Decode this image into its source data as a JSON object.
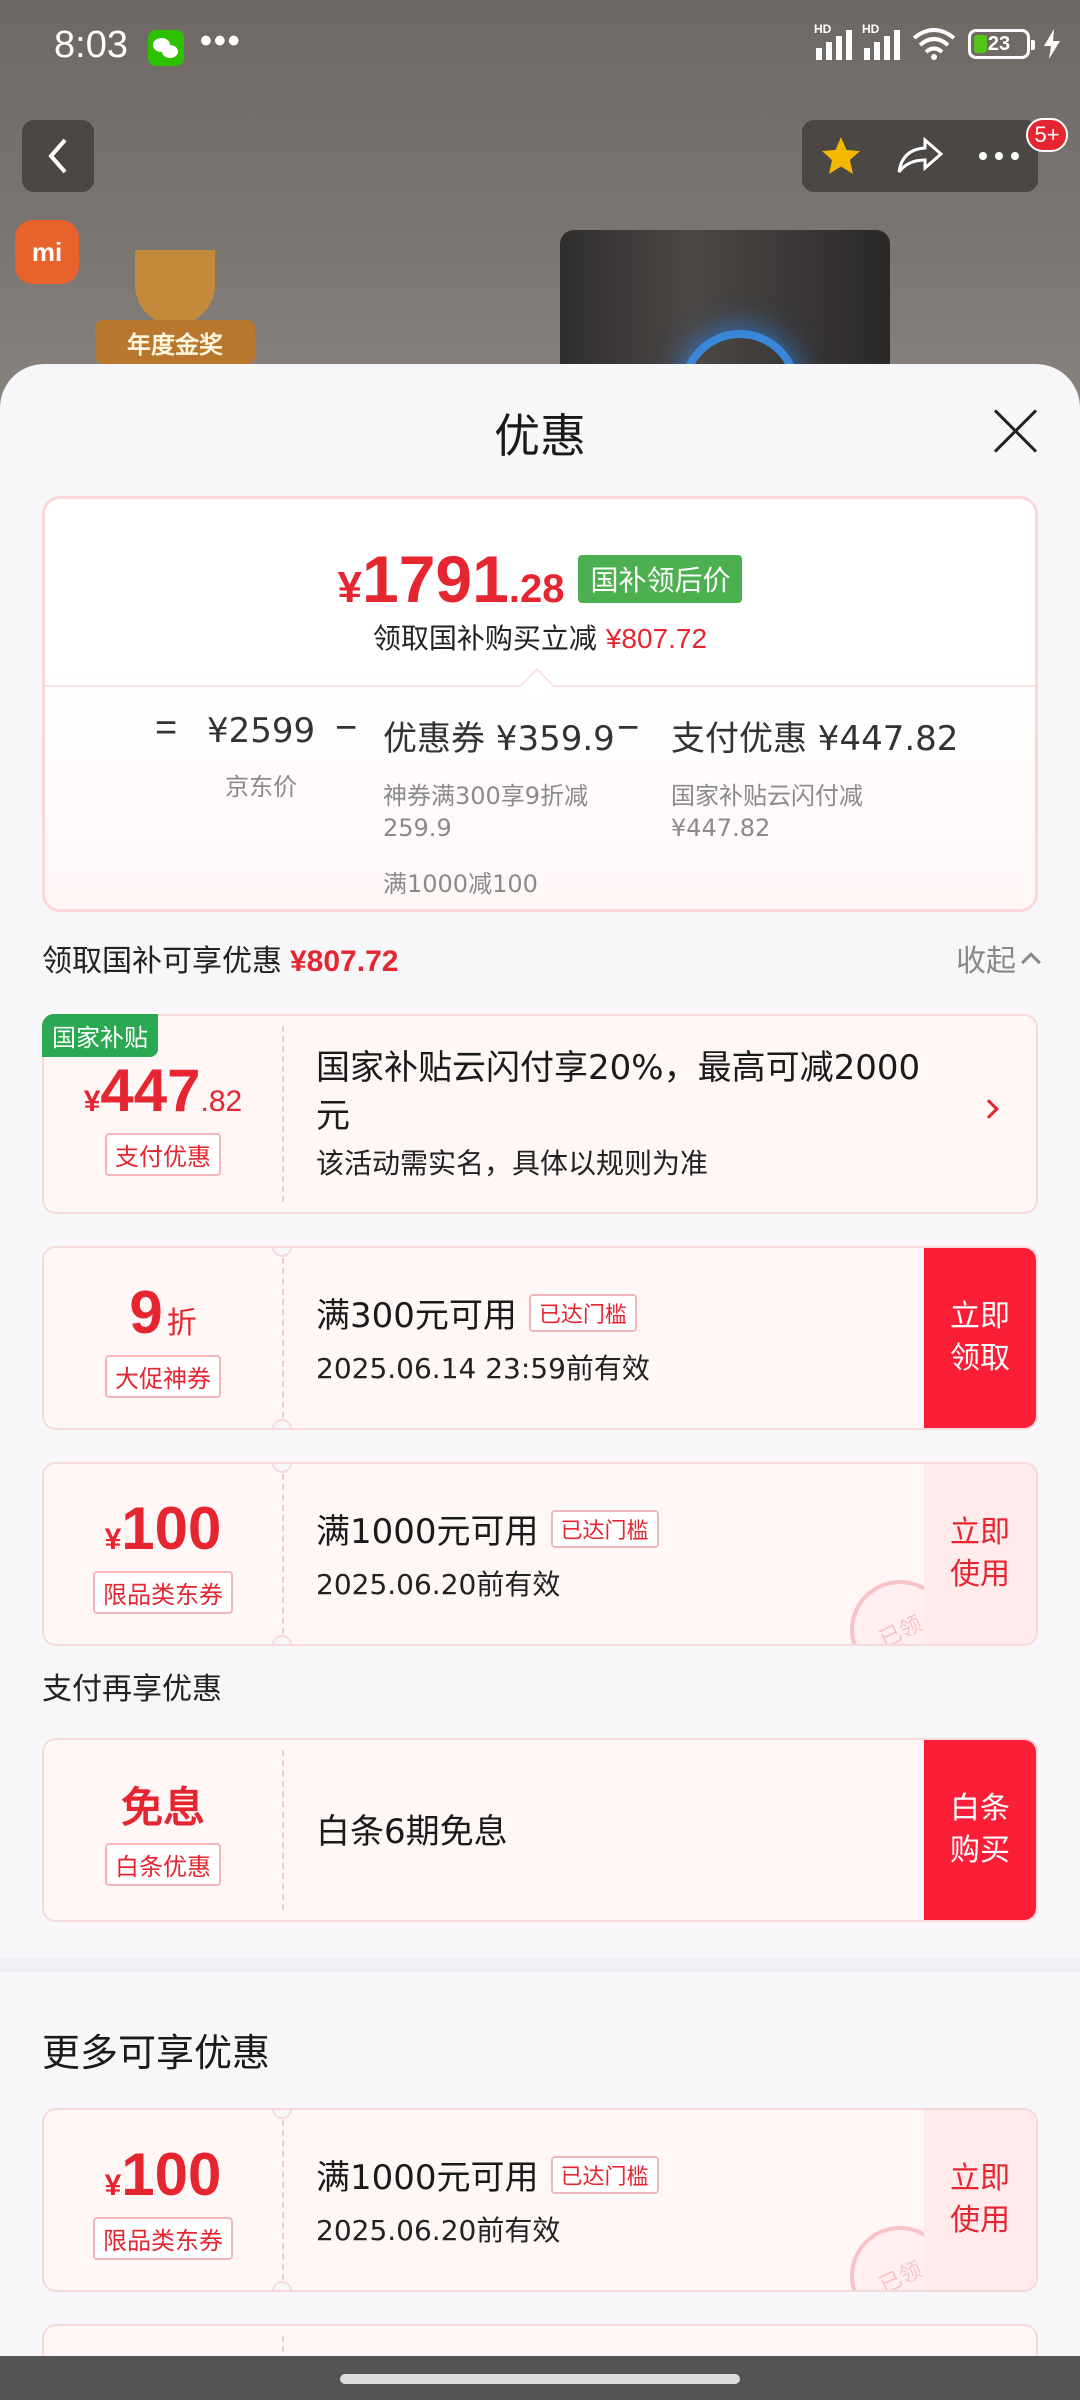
{
  "status_bar": {
    "time": "8:03",
    "dots": "•••",
    "battery": "23"
  },
  "background": {
    "brand_logo": "mi",
    "award_label": "年度金奖"
  },
  "nav": {
    "badge": "5+"
  },
  "sheet": {
    "title": "优惠"
  },
  "summary": {
    "price_symbol": "¥",
    "price_int": "1791",
    "price_dec": ".28",
    "price_tag": "国补领后价",
    "sub_text": "领取国补购买立减",
    "sub_amount": "¥807.72",
    "eq": "=",
    "base_value": "¥2599",
    "base_desc": "京东价",
    "minus": "−",
    "coupon_value": "优惠券 ¥359.9",
    "coupon_desc_1": "神券满300享9折减259.9",
    "coupon_desc_2": "满1000减100",
    "pay_value": "支付优惠 ¥447.82",
    "pay_desc": "国家补贴云闪付减¥447.82"
  },
  "section1": {
    "label": "领取国补可享优惠",
    "amount": "¥807.72",
    "collapse": "收起"
  },
  "subsidy": {
    "badge": "国家补贴",
    "symbol": "¥",
    "int": "447",
    "dec": ".82",
    "pill": "支付优惠",
    "title": "国家补贴云闪付享20%，最高可减2000元",
    "sub": "该活动需实名，具体以规则为准"
  },
  "coupons": [
    {
      "amount": "9",
      "unit": "折",
      "pill": "大促神券",
      "title": "满300元可用",
      "tag": "已达门槛",
      "sub": "2025.06.14 23:59前有效",
      "action": "立即领取"
    },
    {
      "symbol": "¥",
      "amount": "100",
      "pill": "限品类东券",
      "title": "满1000元可用",
      "tag": "已达门槛",
      "sub": "2025.06.20前有效",
      "action": "立即使用",
      "stamp": "已领"
    }
  ],
  "section2": {
    "label": "支付再享优惠"
  },
  "baitiao": {
    "amount": "免息",
    "pill": "白条优惠",
    "title": "白条6期免息",
    "action": "白条购买"
  },
  "section3": {
    "label": "更多可享优惠"
  },
  "more_coupon": {
    "symbol": "¥",
    "amount": "100",
    "pill": "限品类东券",
    "title": "满1000元可用",
    "tag": "已达门槛",
    "sub": "2025.06.20前有效",
    "action": "立即使用",
    "stamp": "已领"
  },
  "colors": {
    "accent_red": "#e52631",
    "button_red": "#fa1e37",
    "subsidy_green": "#2aa952"
  }
}
